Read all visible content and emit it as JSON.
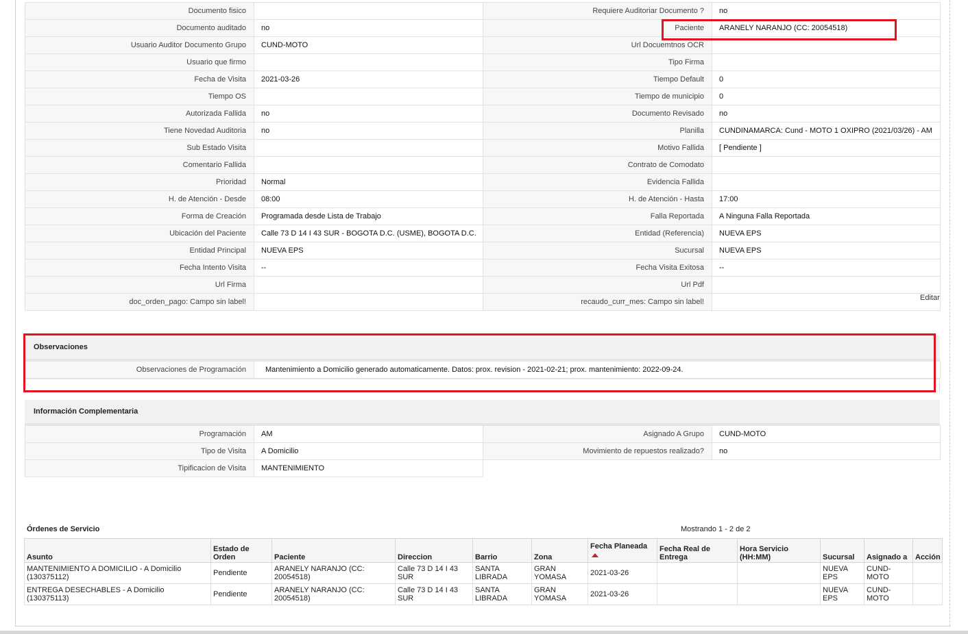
{
  "detail_rows": [
    {
      "l1": "Documento fisico",
      "v1": "",
      "l2": "Requiere Auditoriar Documento ?",
      "v2": "no"
    },
    {
      "l1": "Documento auditado",
      "v1": "no",
      "l2": "Paciente",
      "v2": "ARANELY NARANJO (CC: 20054518)"
    },
    {
      "l1": "Usuario Auditor Documento Grupo",
      "v1": "CUND-MOTO",
      "l2": "Url Docuemtnos OCR",
      "v2": ""
    },
    {
      "l1": "Usuario que firmo",
      "v1": "",
      "l2": "Tipo Firma",
      "v2": ""
    },
    {
      "l1": "Fecha de Visita",
      "v1": "2021-03-26",
      "l2": "Tiempo Default",
      "v2": "0"
    },
    {
      "l1": "Tiempo OS",
      "v1": "",
      "l2": "Tiempo de municipio",
      "v2": "0"
    },
    {
      "l1": "Autorizada Fallida",
      "v1": "no",
      "l2": "Documento Revisado",
      "v2": "no"
    },
    {
      "l1": "Tiene Novedad Auditoria",
      "v1": "no",
      "l2": "Planilla",
      "v2": "CUNDINAMARCA: Cund - MOTO 1 OXIPRO (2021/03/26) - AM"
    },
    {
      "l1": "Sub Estado Visita",
      "v1": "",
      "l2": "Motivo Fallida",
      "v2": "[ Pendiente ]"
    },
    {
      "l1": "Comentario Fallida",
      "v1": "",
      "l2": "Contrato de Comodato",
      "v2": ""
    },
    {
      "l1": "Prioridad",
      "v1": "Normal",
      "l2": "Evidencia Fallida",
      "v2": ""
    },
    {
      "l1": "H. de Atención - Desde",
      "v1": "08:00",
      "l2": "H. de Atención - Hasta",
      "v2": "17:00"
    },
    {
      "l1": "Forma de Creación",
      "v1": "Programada desde Lista de Trabajo",
      "l2": "Falla Reportada",
      "v2": "A Ninguna Falla Reportada"
    },
    {
      "l1": "Ubicación del Paciente",
      "v1": "Calle 73 D 14 I 43 SUR - BOGOTA D.C. (USME), BOGOTA D.C.",
      "l2": "Entidad (Referencia)",
      "v2": "NUEVA EPS"
    },
    {
      "l1": "Entidad Principal",
      "v1": "NUEVA EPS",
      "l2": "Sucursal",
      "v2": "NUEVA EPS"
    },
    {
      "l1": "Fecha Intento Visita",
      "v1": "--",
      "l2": "Fecha Visita Exitosa",
      "v2": "--"
    },
    {
      "l1": "Url Firma",
      "v1": "",
      "l2": "Url Pdf",
      "v2": ""
    },
    {
      "l1": "doc_orden_pago: Campo sin label!",
      "v1": "",
      "l2": "recaudo_curr_mes: Campo sin label!",
      "v2": ""
    }
  ],
  "edit_label": "Editar",
  "observaciones": {
    "title": "Observaciones",
    "label": "Observaciones de Programación",
    "value": "Mantenimiento a Domicilio generado automaticamente. Datos: prox. revision - 2021-02-21; prox. mantenimiento: 2022-09-24."
  },
  "complementaria": {
    "title": "Información Complementaria",
    "rows": [
      {
        "l1": "Programación",
        "v1": "AM",
        "l2": "Asignado A Grupo",
        "v2": "CUND-MOTO"
      },
      {
        "l1": "Tipo de Visita",
        "v1": "A Domicilio",
        "l2": "Movimiento de repuestos realizado?",
        "v2": "no"
      },
      {
        "l1": "Tipificacion de Visita",
        "v1": "MANTENIMIENTO",
        "l2": "",
        "v2": ""
      }
    ]
  },
  "ordenes": {
    "title": "Órdenes de Servicio",
    "count_text": "Mostrando 1 - 2 de 2",
    "columns": [
      "Asunto",
      "Estado de Orden",
      "Paciente",
      "Direccion",
      "Barrio",
      "Zona",
      "Fecha Planeada",
      "Fecha Real de Entrega",
      "Hora Servicio (HH:MM)",
      "Sucursal",
      "Asignado a",
      "Acción"
    ],
    "rows": [
      [
        "MANTENIMIENTO A DOMICILIO - A Domicilio (130375112)",
        "Pendiente",
        "ARANELY NARANJO (CC: 20054518)",
        "Calle 73 D 14 I 43 SUR",
        "SANTA LIBRADA",
        "GRAN YOMASA",
        "2021-03-26",
        "",
        "",
        "NUEVA EPS",
        "CUND-MOTO",
        ""
      ],
      [
        "ENTREGA DESECHABLES - A Domicilio (130375113)",
        "Pendiente",
        "ARANELY NARANJO (CC: 20054518)",
        "Calle 73 D 14 I 43 SUR",
        "SANTA LIBRADA",
        "GRAN YOMASA",
        "2021-03-26",
        "",
        "",
        "NUEVA EPS",
        "CUND-MOTO",
        ""
      ]
    ]
  },
  "colors": {
    "highlight": "#e0141e",
    "sort_arrow": "#c0272d"
  }
}
